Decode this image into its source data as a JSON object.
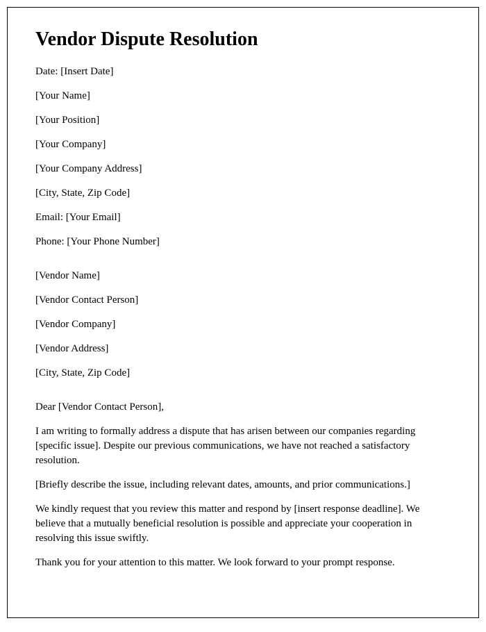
{
  "title": "Vendor Dispute Resolution",
  "sender": {
    "date": "Date: [Insert Date]",
    "name": "[Your Name]",
    "position": "[Your Position]",
    "company": "[Your Company]",
    "address": "[Your Company Address]",
    "citystatezip": "[City, State, Zip Code]",
    "email": "Email: [Your Email]",
    "phone": "Phone: [Your Phone Number]"
  },
  "vendor": {
    "name": "[Vendor Name]",
    "contact": "[Vendor Contact Person]",
    "company": "[Vendor Company]",
    "address": "[Vendor Address]",
    "citystatezip": "[City, State, Zip Code]"
  },
  "body": {
    "salutation": "Dear [Vendor Contact Person],",
    "para1": "I am writing to formally address a dispute that has arisen between our companies regarding [specific issue]. Despite our previous communications, we have not reached a satisfactory resolution.",
    "para2": "[Briefly describe the issue, including relevant dates, amounts, and prior communications.]",
    "para3": "We kindly request that you review this matter and respond by [insert response deadline]. We believe that a mutually beneficial resolution is possible and appreciate your cooperation in resolving this issue swiftly.",
    "para4": "Thank you for your attention to this matter. We look forward to your prompt response."
  }
}
